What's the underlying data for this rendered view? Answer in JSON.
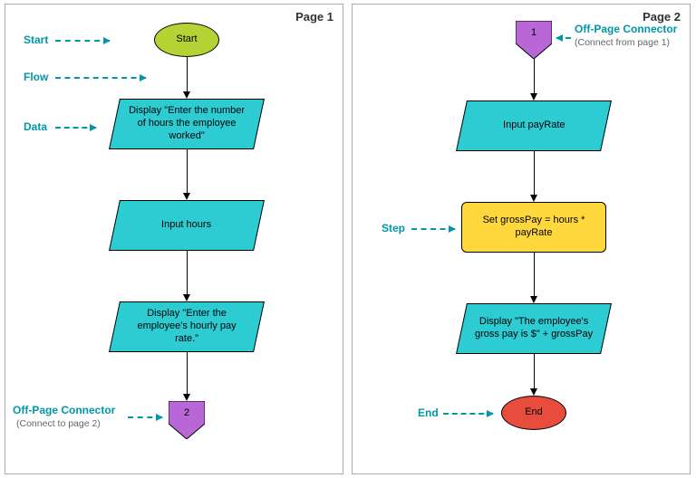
{
  "pages": {
    "p1": {
      "title": "Page 1"
    },
    "p2": {
      "title": "Page 2"
    }
  },
  "annotations": {
    "start": "Start",
    "flow": "Flow",
    "data": "Data",
    "offpage1": "Off-Page Connector",
    "offpage1_sub": "(Connect to page 2)",
    "offpage2": "Off-Page Connector",
    "offpage2_sub": "(Connect from page 1)",
    "step": "Step",
    "end": "End"
  },
  "nodes": {
    "start": "Start",
    "d1": "Display \"Enter the number of hours the employee worked\"",
    "d2": "Input hours",
    "d3": "Display \"Enter the employee's hourly pay rate.\"",
    "conn_out": "2",
    "conn_in": "1",
    "d4": "Input payRate",
    "step1": "Set grossPay = hours * payRate",
    "d5": "Display \"The employee's gross pay is $\" + grossPay",
    "end": "End"
  }
}
